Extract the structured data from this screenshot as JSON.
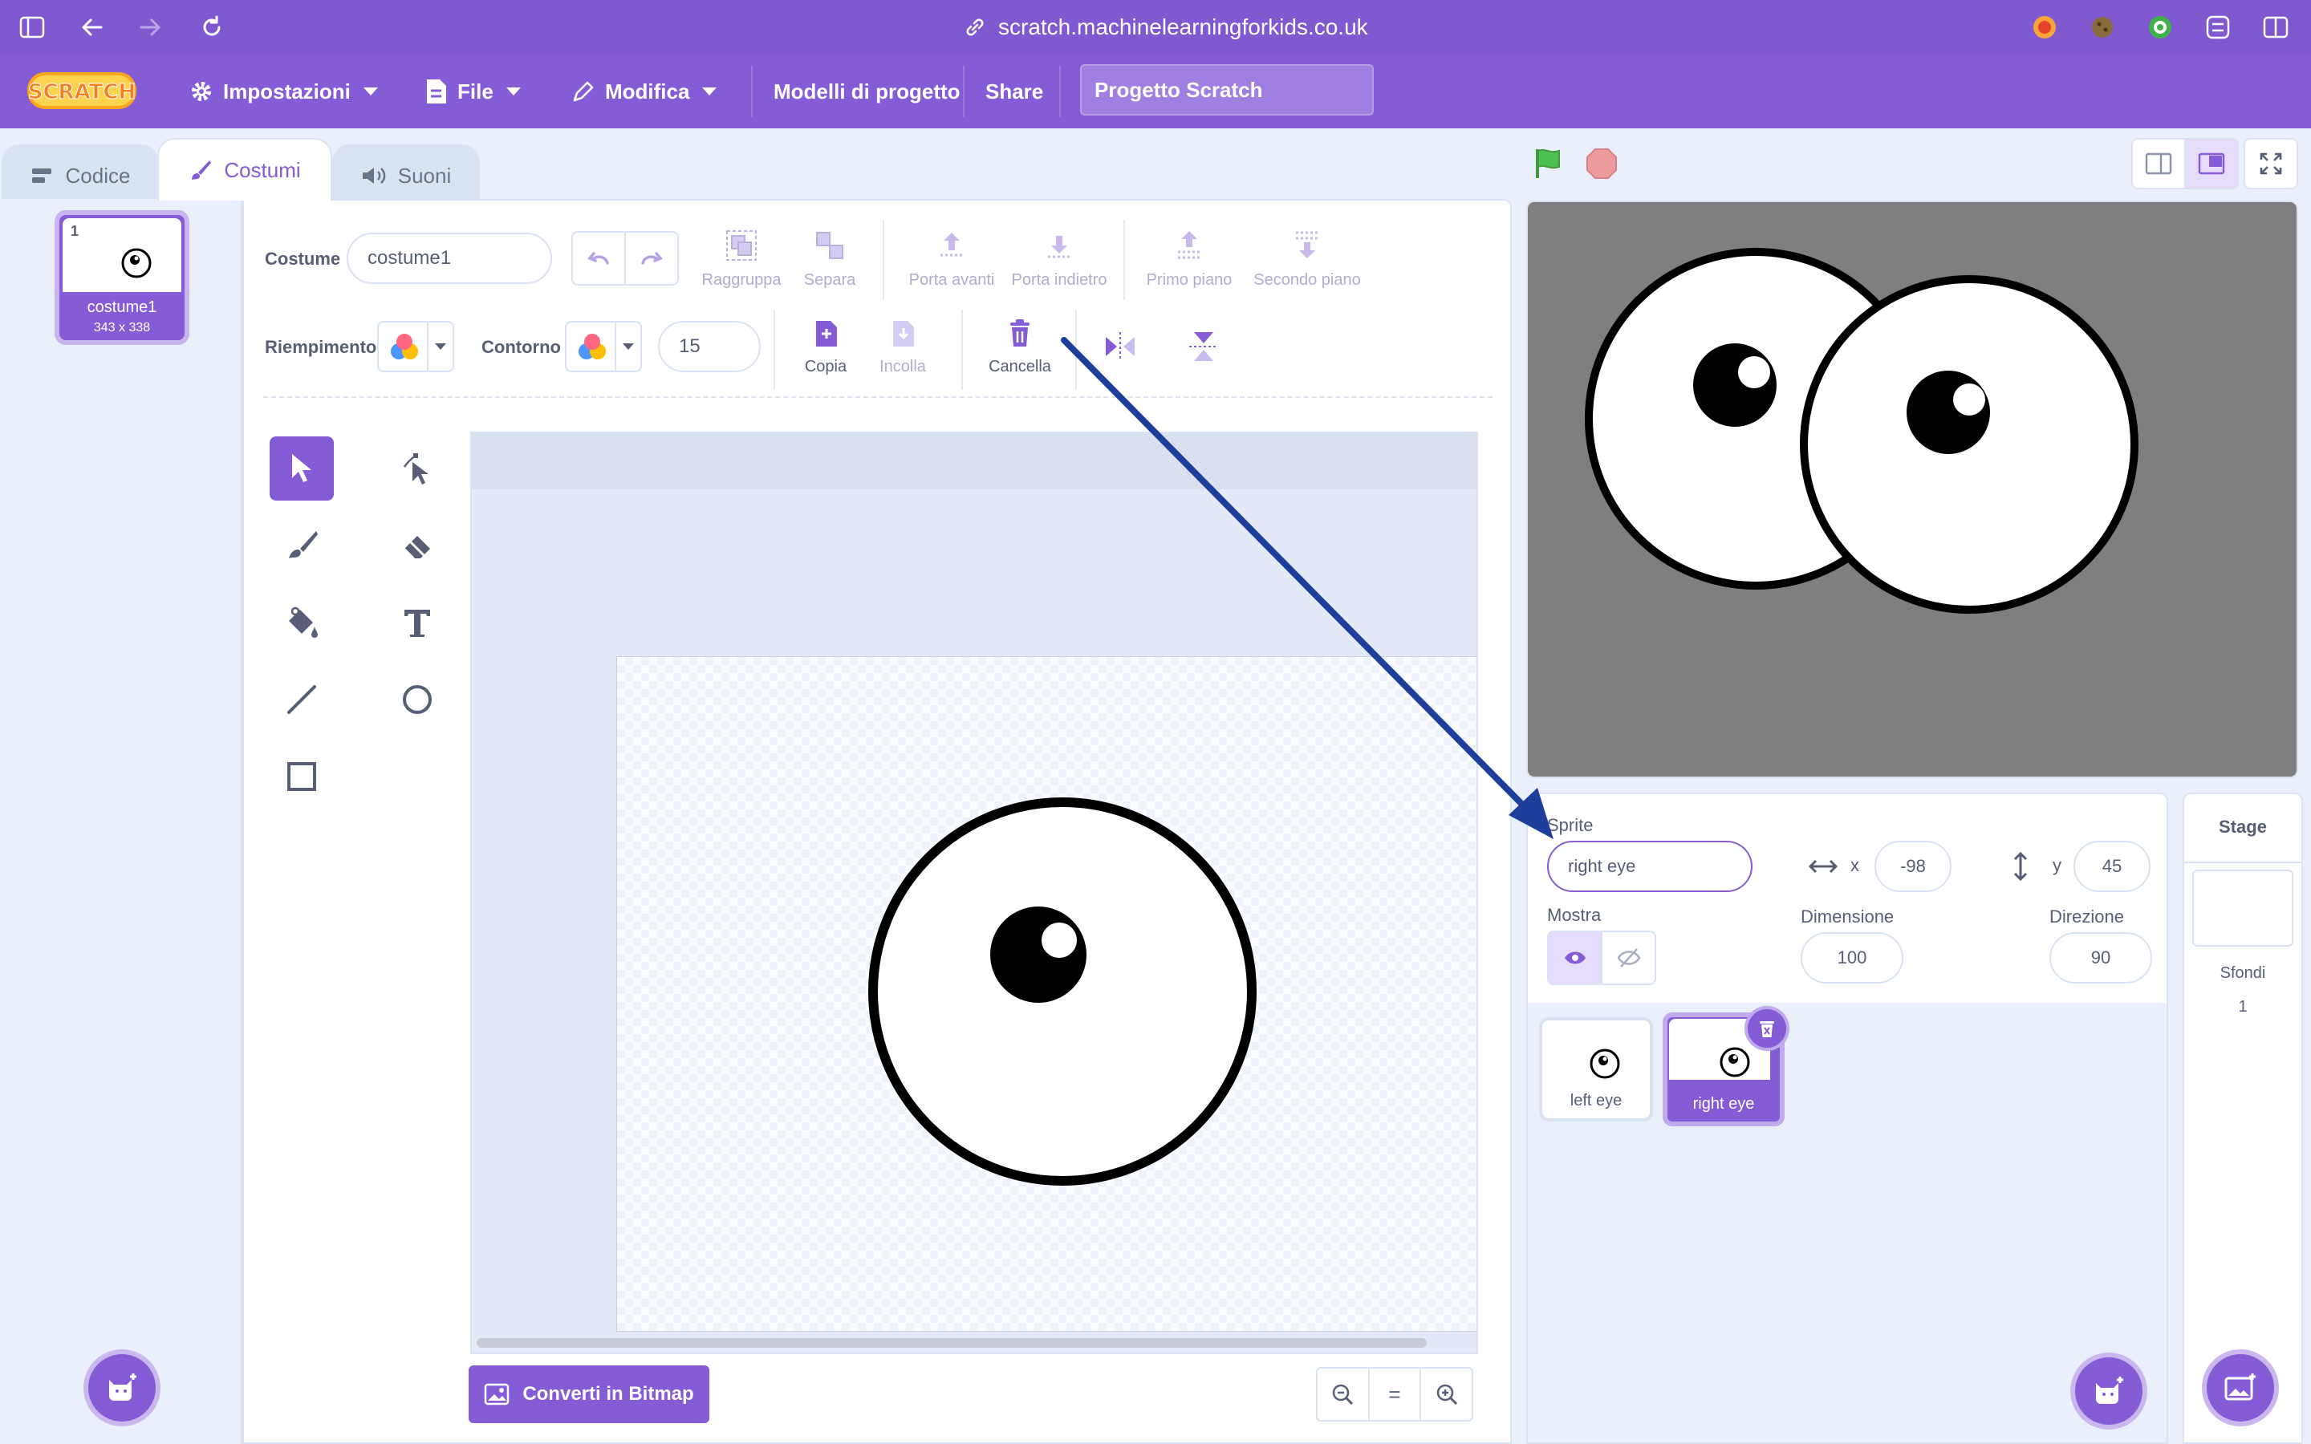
{
  "browser": {
    "url": "scratch.machinelearningforkids.co.uk"
  },
  "menu": {
    "settings_label": "Impostazioni",
    "file_label": "File",
    "edit_label": "Modifica",
    "templates_label": "Modelli di progetto",
    "share_label": "Share",
    "project_title": "Progetto Scratch"
  },
  "tabs": {
    "code": "Codice",
    "costumes": "Costumi",
    "sounds": "Suoni"
  },
  "costume_list": {
    "index": "1",
    "name": "costume1",
    "size": "343 x 338"
  },
  "editor": {
    "costume_label": "Costume",
    "costume_name": "costume1",
    "group": "Raggruppa",
    "ungroup": "Separa",
    "forward": "Porta avanti",
    "backward": "Porta indietro",
    "front": "Primo piano",
    "back": "Secondo piano",
    "fill_label": "Riempimento",
    "outline_label": "Contorno",
    "outline_width": "15",
    "copy": "Copia",
    "paste": "Incolla",
    "delete": "Cancella",
    "convert_bitmap": "Converti in Bitmap",
    "zoom_reset": "="
  },
  "sprite_info": {
    "sprite_label": "Sprite",
    "sprite_name": "right eye",
    "x_label": "x",
    "x_value": "-98",
    "y_label": "y",
    "y_value": "45",
    "show_label": "Mostra",
    "size_label": "Dimensione",
    "size_value": "100",
    "direction_label": "Direzione",
    "direction_value": "90"
  },
  "sprites": [
    {
      "name": "left eye"
    },
    {
      "name": "right eye"
    }
  ],
  "stage_pane": {
    "title": "Stage",
    "backdrops_label": "Sfondi",
    "backdrops_count": "1"
  },
  "colors": {
    "accent": "#855cd6",
    "browser": "#8059d0",
    "annotation_arrow": "#1e3e9c"
  }
}
